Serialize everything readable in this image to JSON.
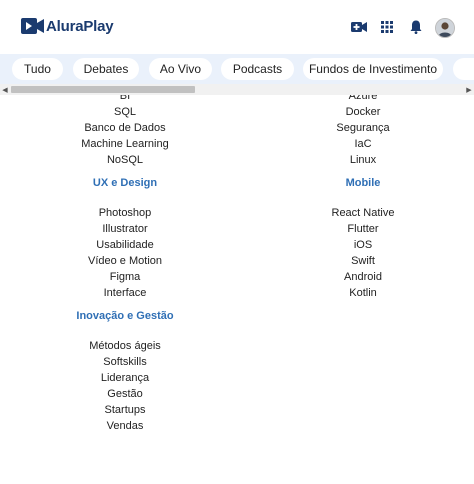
{
  "header": {
    "logo_text": "AluraPlay",
    "icons": [
      "video-camera-icon",
      "apps-grid-icon",
      "bell-icon",
      "avatar"
    ]
  },
  "chips": [
    "Tudo",
    "Debates",
    "Ao Vivo",
    "Podcasts",
    "Fundos de Investimento"
  ],
  "columns": {
    "left": {
      "partial_top_item": "BI",
      "top_items": [
        "SQL",
        "Banco de Dados",
        "Machine Learning",
        "NoSQL"
      ],
      "section_ux": "UX e Design",
      "ux_items": [
        "Photoshop",
        "Illustrator",
        "Usabilidade",
        "Vídeo e Motion",
        "Figma",
        "Interface"
      ],
      "section_inov": "Inovação e Gestão",
      "inov_items": [
        "Métodos ágeis",
        "Softskills",
        "Liderança",
        "Gestão",
        "Startups",
        "Vendas"
      ]
    },
    "right": {
      "partial_top_item": "Azure",
      "top_items": [
        "Docker",
        "Segurança",
        "IaC",
        "Linux"
      ],
      "section_mobile": "Mobile",
      "mobile_items": [
        "React Native",
        "Flutter",
        "iOS",
        "Swift",
        "Android",
        "Kotlin"
      ]
    }
  },
  "colors": {
    "accent": "#2f6fb5",
    "logo": "#1b3b6f",
    "chips_bg": "#eaf1fb"
  }
}
